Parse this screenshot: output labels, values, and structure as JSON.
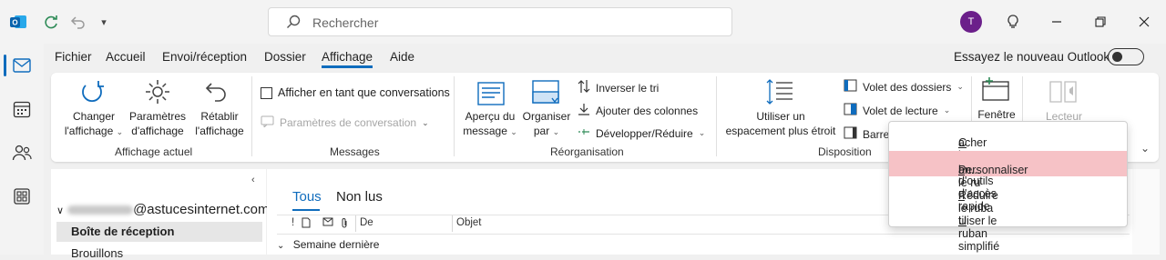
{
  "titlebar": {
    "search_placeholder": "Rechercher",
    "avatar_initial": "T"
  },
  "menu": {
    "tabs": [
      "Fichier",
      "Accueil",
      "Envoi/réception",
      "Dossier",
      "Affichage",
      "Aide"
    ],
    "active_tab": "Affichage",
    "try_new_outlook": "Essayez le nouveau Outlook"
  },
  "ribbon": {
    "change_view": [
      "Changer",
      "l'affichage"
    ],
    "view_settings": [
      "Paramètres",
      "d'affichage"
    ],
    "reset_view": [
      "Rétablir",
      "l'affichage"
    ],
    "group_current_view": "Affichage actuel",
    "show_as_conversations": "Afficher en tant que conversations",
    "conversation_settings": "Paramètres de conversation",
    "group_messages": "Messages",
    "message_preview": [
      "Aperçu du",
      "message"
    ],
    "arrange_by": [
      "Organiser",
      "par"
    ],
    "reverse_sort": "Inverser le tri",
    "add_columns": "Ajouter des colonnes",
    "expand_collapse": "Développer/Réduire",
    "group_arrangement": "Réorganisation",
    "use_tighter_spacing": [
      "Utiliser un",
      "espacement plus étroit"
    ],
    "folder_pane": "Volet des dossiers",
    "reading_pane": "Volet de lecture",
    "todo_bar_partial": "Barre",
    "group_layout": "Disposition",
    "window": "Fenêtre",
    "reader": "Lecteur"
  },
  "folders": {
    "account_suffix": "@astucesinternet.com",
    "inbox": "Boîte de réception",
    "drafts": "Brouillons"
  },
  "mail": {
    "tab_all": "Tous",
    "tab_unread": "Non lus",
    "col_from": "De",
    "col_subject": "Objet",
    "group_last_week": "Semaine dernière"
  },
  "context_menu": {
    "items": [
      {
        "pre": "",
        "u": "C",
        "post": "acher la barre d'outils d'accès rapide"
      },
      {
        "pre": "Personnaliser le ru",
        "u": "b",
        "post": "an..."
      },
      {
        "pre": "Réduire le ruba",
        "u": "n",
        "post": ""
      },
      {
        "pre": "",
        "u": "U",
        "post": "tiliser le ruban simplifié"
      }
    ]
  },
  "colors": {
    "accent": "#0f6cbd",
    "avatar": "#6b1f8a",
    "highlight": "#f6c2c6"
  }
}
